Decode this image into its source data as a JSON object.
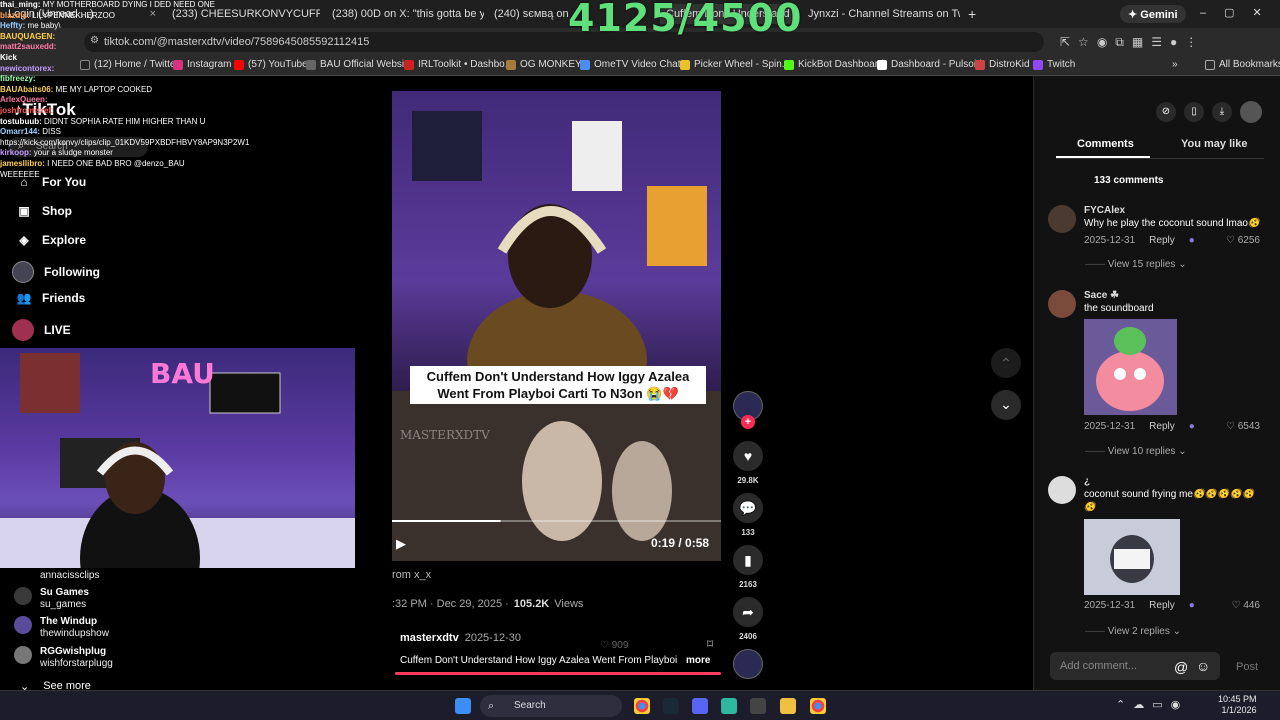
{
  "overlay": {
    "counter": "4125/4500"
  },
  "browser": {
    "tabs": [
      {
        "label": "Login (Unread ...)",
        "x": "×"
      },
      {
        "label": "(233) CHEESURKONVYCUFFEM",
        "x": "×"
      },
      {
        "label": "(238) 00D on X: \"this gotta be y",
        "x": "×"
      },
      {
        "label": "(240) ѕємвą on X",
        "x": "×"
      },
      {
        "label": "Cuffem Don't Understand",
        "x": "×"
      },
      {
        "label": "Jynxzi - Channel Streams on Tw",
        "x": "×"
      }
    ],
    "new_tab": "+",
    "gemini": "Gemini",
    "url": "tiktok.com/@masterxdtv/video/7589645085592112415",
    "bookmarks": [
      "(12) Home / Twitter",
      "Instagram",
      "(57) YouTube",
      "BAU Official Website",
      "IRLToolkit • Dashbo...",
      "OG MONKEY",
      "OmeTV Video Chat...",
      "Picker Wheel - Spin...",
      "KickBot Dashboard",
      "Dashboard - Pulsoid",
      "DistroKid",
      "Twitch"
    ],
    "all_bookmarks": "All Bookmarks"
  },
  "chat": [
    {
      "user": "thai_ming:",
      "msg": "MY MOTHERBOARD DYING I DED NEED ONE",
      "color": "#ffffff"
    },
    {
      "user": "blazdis:",
      "msg": "LILYPENNEKHERZOO",
      "color": "#ff9b4a"
    },
    {
      "user": "Heffty:",
      "msg": "me baby\\",
      "color": "#9bd0ff"
    },
    {
      "user": "BAUQUAGEN:",
      "msg": "",
      "color": "#ffd24a"
    },
    {
      "user": "matt2sauxedd:",
      "msg": "",
      "color": "#ff7aa8"
    },
    {
      "user": "Kick",
      "msg": "",
      "color": "#ffffff"
    },
    {
      "user": "newicontorex:",
      "msg": "",
      "color": "#c79bff"
    },
    {
      "user": "fibfreezy:",
      "msg": "",
      "color": "#9bffb0"
    },
    {
      "user": "BAUAbaits06:",
      "msg": "ME MY LAPTOP COOKED",
      "color": "#ffd24a"
    },
    {
      "user": "",
      "msg": "",
      "color": "#ffffff"
    },
    {
      "user": "ArlexQueen:",
      "msg": "",
      "color": "#ff7aa8"
    },
    {
      "user": "joshfromisrel:",
      "msg": "",
      "color": "#ff5a5a"
    },
    {
      "user": "tostubuub:",
      "msg": "DIDNT SOPHIA RATE HIM HIGHER THAN U",
      "color": "#ffffff"
    },
    {
      "user": "Omarr144:",
      "msg": "DISS",
      "color": "#9bd0ff"
    },
    {
      "user": "",
      "msg": "https://kick.com/konvy/clips/clip_01KDV59PXBDFHBVY8AP9N3P2W1",
      "color": "#ffffff"
    },
    {
      "user": "kirkoop:",
      "msg": "your a sludge monster",
      "color": "#c79bff"
    },
    {
      "user": "jamesllibro:",
      "msg": "I NEED ONE BAD BRO @denzo_BAU",
      "color": "#ffd24a"
    },
    {
      "user": "",
      "msg": "WEEEEEE",
      "color": "#ffffff"
    }
  ],
  "tiktok": {
    "logo": "TikTok",
    "search": "Search",
    "nav": [
      {
        "label": "For You",
        "icon": "home-icon"
      },
      {
        "label": "Shop",
        "icon": "shop-icon"
      },
      {
        "label": "Explore",
        "icon": "compass-icon"
      },
      {
        "label": "Following",
        "icon": "following-icon"
      },
      {
        "label": "Friends",
        "icon": "friends-icon"
      },
      {
        "label": "LIVE",
        "icon": "live-icon"
      }
    ],
    "following": [
      {
        "name": "",
        "handle": "annacissclips"
      },
      {
        "name": "Su Games",
        "handle": "su_games"
      },
      {
        "name": "The Windup",
        "handle": "thewindupshow"
      },
      {
        "name": "RGGwishplug",
        "handle": "wishforstarplugg"
      }
    ],
    "see_more": "See more",
    "video": {
      "caption": "Cuffem Don't Understand How Iggy Azalea Went From Playboi Carti To N3on 😭💔",
      "watermark": "MASTERXDTV",
      "time": "0:19 / 0:58",
      "progress": 0.33,
      "tweet_from": "rom x_x",
      "tweet_date": ":32 PM · Dec 29, 2025 ·",
      "tweet_views": "105.2K",
      "tweet_views_label": "Views",
      "ghost_likes": "909",
      "author": "masterxdtv",
      "date": "2025-12-30",
      "desc": "Cuffem Don't Understand How Iggy Azalea Went From Playboi",
      "more": "more"
    },
    "actions": {
      "likes": "29.8K",
      "comments": "133",
      "saves": "2163",
      "shares": "2406"
    },
    "comments_panel": {
      "tab_comments": "Comments",
      "tab_like": "You may like",
      "count": "133 comments",
      "add_placeholder": "Add comment...",
      "post": "Post",
      "comments": [
        {
          "user": "FYCAlex",
          "text": "Why he play the coconut sound lmao🫨",
          "date": "2025-12-31",
          "reply": "Reply",
          "likes": "6256",
          "replies": "View 15 replies"
        },
        {
          "user": "Sace ☘",
          "text": "the soundboard",
          "date": "2025-12-31",
          "reply": "Reply",
          "likes": "6543",
          "replies": "View 10 replies"
        },
        {
          "user": "¿",
          "text": "coconut sound frying me🫨🫨🫨🫨🫨🫨",
          "date": "2025-12-31",
          "reply": "Reply",
          "likes": "446",
          "replies": "View 2 replies"
        }
      ]
    }
  },
  "taskbar": {
    "search": "Search",
    "time": "10:45 PM",
    "date": "1/1/2026"
  }
}
